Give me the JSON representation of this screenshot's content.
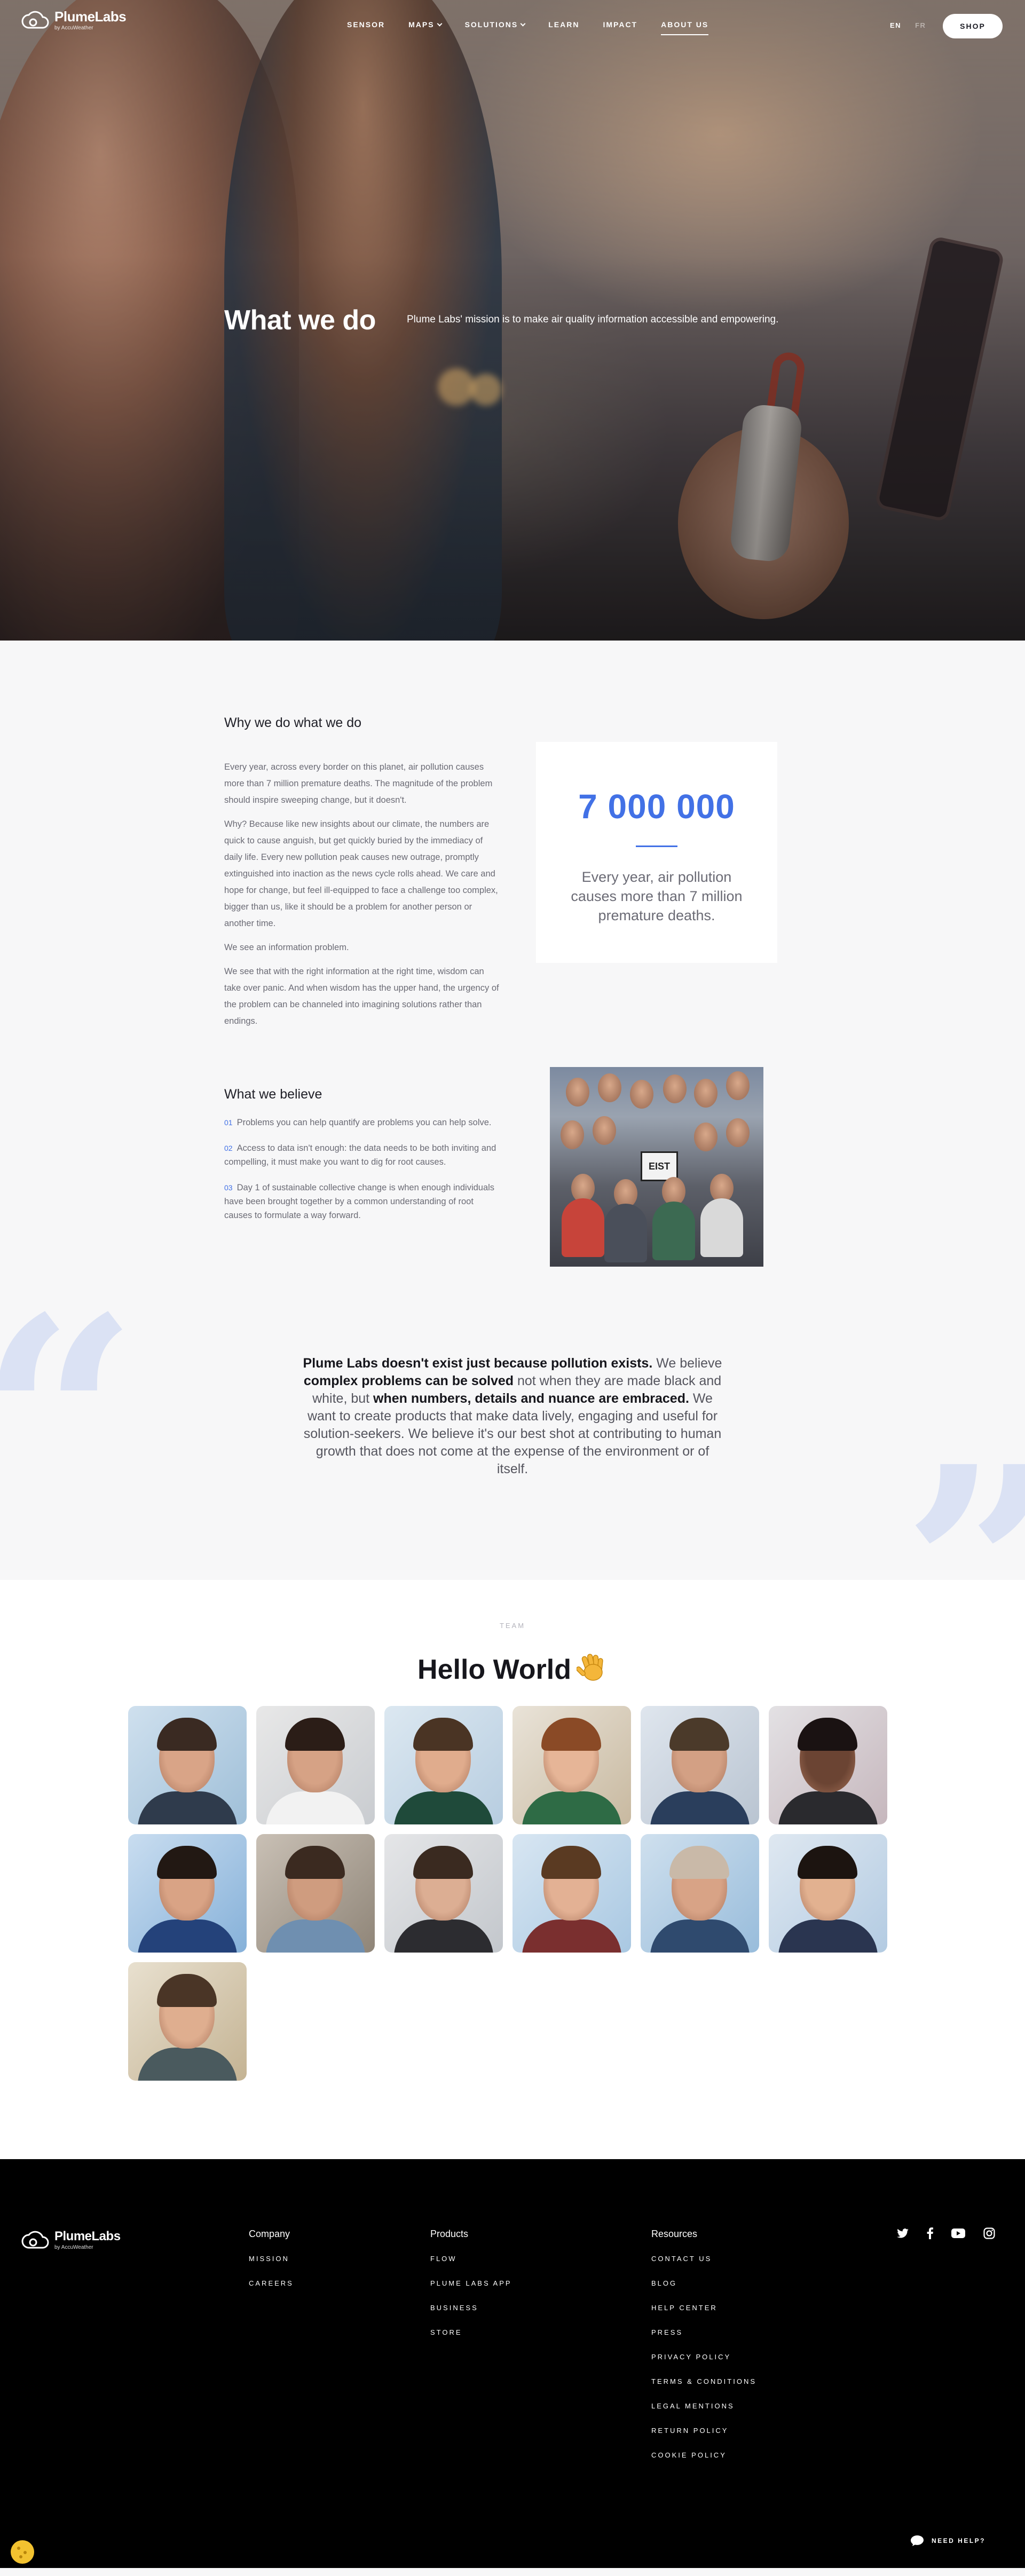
{
  "nav": {
    "logo_text": "PlumeLabs",
    "logo_sub": "by AccuWeather",
    "menu": [
      {
        "label": "Sensor",
        "has_dropdown": false
      },
      {
        "label": "Maps",
        "has_dropdown": true
      },
      {
        "label": "Solutions",
        "has_dropdown": true
      },
      {
        "label": "Learn",
        "has_dropdown": false
      },
      {
        "label": "Impact",
        "has_dropdown": false
      },
      {
        "label": "About us",
        "has_dropdown": false,
        "active": true
      }
    ],
    "lang_en": "EN",
    "lang_fr": "FR",
    "shop_label": "SHOP"
  },
  "hero": {
    "title": "What we do",
    "mission": "Plume Labs' mission is to make air quality information accessible and empowering."
  },
  "why": {
    "title": "Why we do what we do",
    "paragraphs": [
      "Every year, across every border on this planet, air pollution causes more than 7 million premature deaths. The magnitude of the problem should inspire sweeping change, but it doesn't.",
      "Why? Because like new insights about our climate, the numbers are quick to cause anguish, but get quickly buried by the immediacy of daily life. Every new pollution peak causes new outrage, promptly extinguished into inaction as the news cycle rolls ahead. We care and hope for change, but feel ill-equipped to face a challenge too complex, bigger than us, like it should be a problem for another person or another time.",
      "We see an information problem.",
      "We see that with the right information at the right time, wisdom can take over panic. And when wisdom has the upper hand, the urgency of the problem can be channeled into imagining solutions rather than endings."
    ],
    "stat_number": "7 000 000",
    "stat_caption": "Every year, air pollution causes more than 7 million premature deaths."
  },
  "believe": {
    "title": "What we believe",
    "items": [
      {
        "num": "01",
        "text": "Problems you can help quantify are problems you can help solve."
      },
      {
        "num": "02",
        "text": "Access to data isn't enough: the data needs to be both inviting and compelling, it must make you want to dig for root causes."
      },
      {
        "num": "03",
        "text": "Day 1 of sustainable collective change is when enough individuals have been brought together by a common understanding of root causes to formulate a way forward."
      }
    ],
    "photo_sign": "EIST"
  },
  "quote": {
    "bold1": "Plume Labs doesn't exist just because pollution exists.",
    "text1": " We believe ",
    "bold2": "complex problems can be solved",
    "text2": " not when they are made black and white, but ",
    "bold3": "when numbers, details and nuance are embraced.",
    "text3": " We want to create products that make data lively, engaging and useful for solution-seekers. We believe it's our best shot at contributing to human growth that does not come at the expense of the environment or of itself."
  },
  "team": {
    "label": "TEAM",
    "title": "Hello World",
    "member_count": 13
  },
  "footer": {
    "logo_text": "PlumeLabs",
    "logo_sub": "by AccuWeather",
    "company": {
      "title": "Company",
      "links": [
        "Mission",
        "Careers"
      ]
    },
    "products": {
      "title": "Products",
      "links": [
        "Flow",
        "Plume Labs App",
        "Business",
        "Store"
      ]
    },
    "resources": {
      "title": "Resources",
      "links": [
        "Contact us",
        "Blog",
        "Help center",
        "Press",
        "Privacy policy",
        "Terms & conditions",
        "Legal mentions",
        "Return policy",
        "Cookie policy"
      ]
    },
    "social": [
      "twitter-icon",
      "facebook-icon",
      "youtube-icon",
      "instagram-icon"
    ],
    "help_label": "NEED HELP?"
  },
  "colors": {
    "accent_blue": "#4271e6",
    "quote_mark": "#dbe2f4",
    "footer_bg": "#000000"
  }
}
